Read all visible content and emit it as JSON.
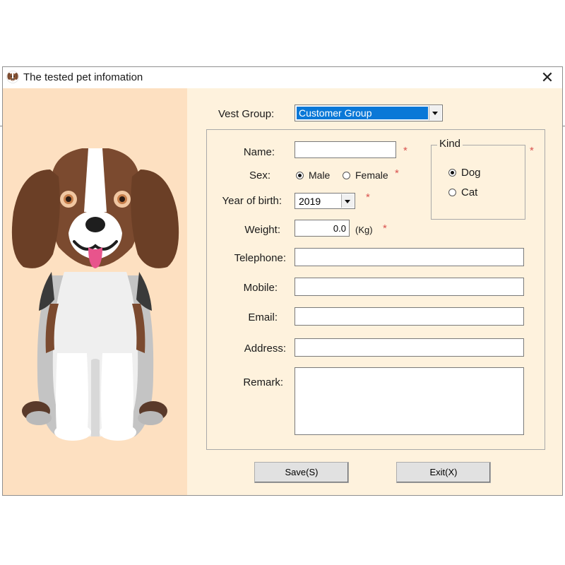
{
  "window": {
    "title": "The tested pet infomation",
    "close_glyph": "✕"
  },
  "form": {
    "vest_group": {
      "label": "Vest Group:",
      "value": "Customer Group"
    },
    "name": {
      "label": "Name:",
      "value": ""
    },
    "sex": {
      "label": "Sex:",
      "options": [
        "Male",
        "Female"
      ],
      "selected": "Male"
    },
    "kind": {
      "title": "Kind",
      "options": [
        "Dog",
        "Cat"
      ],
      "selected": "Dog"
    },
    "year_of_birth": {
      "label": "Year of birth:",
      "value": "2019"
    },
    "weight": {
      "label": "Weight:",
      "value": "0.0",
      "unit": "(Kg)"
    },
    "telephone": {
      "label": "Telephone:",
      "value": ""
    },
    "mobile": {
      "label": "Mobile:",
      "value": ""
    },
    "email": {
      "label": "Email:",
      "value": ""
    },
    "address": {
      "label": "Address:",
      "value": ""
    },
    "remark": {
      "label": "Remark:",
      "value": ""
    },
    "required_mark": "*"
  },
  "buttons": {
    "save": "Save(S)",
    "exit": "Exit(X)"
  },
  "colors": {
    "left_panel": "#fde0c1",
    "right_panel": "#fef2dd",
    "selection": "#0a78d7",
    "required": "#d9534f"
  },
  "icons": {
    "app": "dog-face-icon",
    "close": "close-icon",
    "dropdown": "chevron-down-icon"
  }
}
